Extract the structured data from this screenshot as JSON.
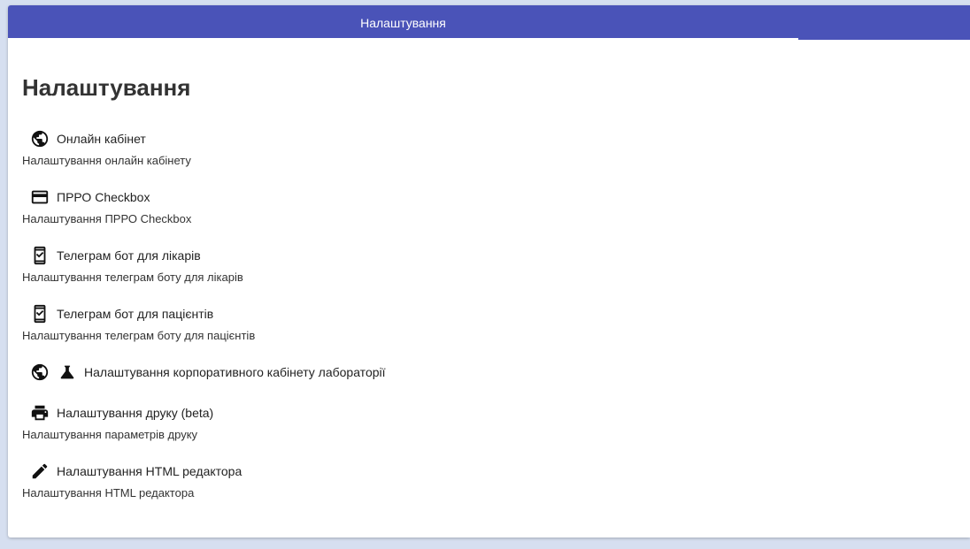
{
  "tabs": {
    "active_label": "Налаштування"
  },
  "page": {
    "title": "Налаштування"
  },
  "settings": [
    {
      "title": "Онлайн кабінет",
      "description": "Налаштування онлайн кабінету",
      "icons": [
        "globe-icon"
      ]
    },
    {
      "title": "ПРРО Checkbox",
      "description": "Налаштування ПРРО Checkbox",
      "icons": [
        "credit-card-icon"
      ]
    },
    {
      "title": "Телеграм бот для лікарів",
      "description": "Налаштування телеграм боту для лікарів",
      "icons": [
        "phone-check-icon"
      ]
    },
    {
      "title": "Телеграм бот для пацієнтів",
      "description": "Налаштування телеграм боту для пацієнтів",
      "icons": [
        "phone-check-icon"
      ]
    },
    {
      "title": "Налаштування корпоративного кабінету лабораторії",
      "icons": [
        "globe-icon",
        "flask-icon"
      ]
    },
    {
      "title": "Налаштування друку (beta)",
      "description": "Налаштування параметрів друку",
      "icons": [
        "printer-icon"
      ]
    },
    {
      "title": "Налаштування HTML редактора",
      "description": "Налаштування HTML редактора",
      "icons": [
        "pencil-icon"
      ]
    }
  ],
  "colors": {
    "tabbar": "#4a53b8",
    "background": "#d6dff0"
  }
}
